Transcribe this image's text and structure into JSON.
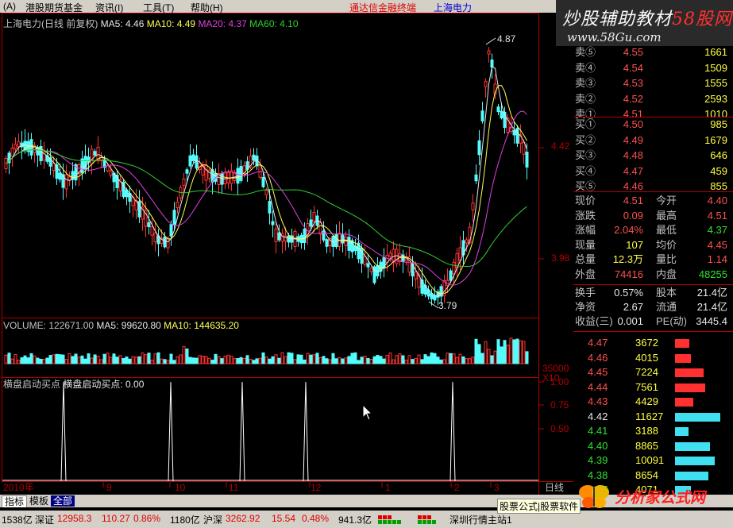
{
  "menu": {
    "items": [
      "(A)",
      "港股期货基金",
      "资讯(I)",
      "工具(T)",
      "帮助(H)"
    ],
    "app_title": "通达信金融终端",
    "stock_name": "上海电力"
  },
  "watermark_top": {
    "line1_a": "炒股辅助教材",
    "line1_b": "58股网",
    "line2": "www.58Gu.com"
  },
  "chart": {
    "header": {
      "name": "上海电力(日线 前复权)",
      "ma5": "MA5: 4.46",
      "ma10": "MA10: 4.49",
      "ma20": "MA20: 4.37",
      "ma60": "MA60: 4.10"
    },
    "price_labels": {
      "high_mark": "4.87",
      "low_mark": "3.79",
      "axis_a": "4.42",
      "axis_b": "3.98"
    },
    "volume_header": {
      "vol": "VOLUME: 122671.00",
      "ma5": "MA5: 99620.80",
      "ma10": "MA10: 144635.20"
    },
    "volume_axis": {
      "v1": "35000",
      "v2": "X10"
    },
    "indicator_header": {
      "name": "横盘启动买点",
      "value_label": "横盘启动买点: 0.00"
    },
    "indicator_axis": [
      "1.00",
      "0.75",
      "0.50"
    ],
    "x_axis": [
      "2010年",
      "9",
      "10",
      "11",
      "12",
      "1",
      "2",
      "3"
    ],
    "period": "日线"
  },
  "chart_data": [
    {
      "type": "line",
      "title": "上海电力(日线 前复权)",
      "series": [
        {
          "name": "横盘启动买点",
          "x_peaks": [
            "2010-08",
            "2010-10",
            "2010-11",
            "2010-12",
            "2011-02"
          ],
          "values": [
            1,
            1,
            1,
            1,
            1
          ]
        }
      ],
      "ylim": [
        0,
        1
      ]
    }
  ],
  "quote": {
    "asks": [
      {
        "label": "卖⑤",
        "price": "4.55",
        "vol": "1661"
      },
      {
        "label": "卖④",
        "price": "4.54",
        "vol": "1509"
      },
      {
        "label": "卖③",
        "price": "4.53",
        "vol": "1555"
      },
      {
        "label": "卖②",
        "price": "4.52",
        "vol": "2593"
      },
      {
        "label": "卖①",
        "price": "4.51",
        "vol": "1010"
      }
    ],
    "bids": [
      {
        "label": "买①",
        "price": "4.50",
        "vol": "985"
      },
      {
        "label": "买②",
        "price": "4.49",
        "vol": "1679"
      },
      {
        "label": "买③",
        "price": "4.48",
        "vol": "646"
      },
      {
        "label": "买④",
        "price": "4.47",
        "vol": "459"
      },
      {
        "label": "买⑤",
        "price": "4.46",
        "vol": "855"
      }
    ],
    "stats": [
      {
        "l1": "现价",
        "v1": "4.51",
        "l2": "今开",
        "v2": "4.40"
      },
      {
        "l1": "涨跌",
        "v1": "0.09",
        "l2": "最高",
        "v2": "4.51"
      },
      {
        "l1": "涨幅",
        "v1": "2.04%",
        "l2": "最低",
        "v2": "4.37"
      },
      {
        "l1": "现量",
        "v1": "107",
        "l2": "均价",
        "v2": "4.45"
      },
      {
        "l1": "总量",
        "v1": "12.3万",
        "l2": "量比",
        "v2": "1.14"
      },
      {
        "l1": "外盘",
        "v1": "74416",
        "l2": "内盘",
        "v2": "48255"
      }
    ],
    "stats2": [
      {
        "l1": "换手",
        "v1": "0.57%",
        "l2": "股本",
        "v2": "21.4亿"
      },
      {
        "l1": "净资",
        "v1": "2.67",
        "l2": "流通",
        "v2": "21.4亿"
      },
      {
        "l1": "收益(三)",
        "v1": "0.001",
        "l2": "PE(动)",
        "v2": "3445.4"
      }
    ],
    "depth": [
      {
        "price": "4.47",
        "vol": "3672",
        "frac": 0.12
      },
      {
        "price": "4.46",
        "vol": "4015",
        "frac": 0.13
      },
      {
        "price": "4.45",
        "vol": "7224",
        "frac": 0.24
      },
      {
        "price": "4.44",
        "vol": "7561",
        "frac": 0.25
      },
      {
        "price": "4.43",
        "vol": "4429",
        "frac": 0.15
      },
      {
        "price": "4.42",
        "vol": "11627",
        "frac": 0.38
      },
      {
        "price": "4.41",
        "vol": "3188",
        "frac": 0.11
      },
      {
        "price": "4.40",
        "vol": "8865",
        "frac": 0.29
      },
      {
        "price": "4.39",
        "vol": "10091",
        "frac": 0.33
      },
      {
        "price": "4.38",
        "vol": "8654",
        "frac": 0.28
      },
      {
        "price": "4.37",
        "vol": "4071",
        "frac": 0.13
      }
    ]
  },
  "bottom_tabs": [
    "指标",
    "模板",
    "全部"
  ],
  "status": {
    "s0": "1538亿",
    "sz_label": "深证",
    "sz_value": "12958.3",
    "sz_change": "110.27",
    "sz_pct": "0.86%",
    "sz_amount": "1180亿",
    "hs_label": "沪深",
    "hs_value": "3262.92",
    "hs_change": "15.54",
    "hs_pct": "0.48%",
    "hs_amount": "941.3亿",
    "site": "深圳行情主站1",
    "formula": "股票公式|股票软件"
  },
  "watermark_bottom": {
    "text": "分析家公式网",
    "url": "www.88gs.com"
  }
}
